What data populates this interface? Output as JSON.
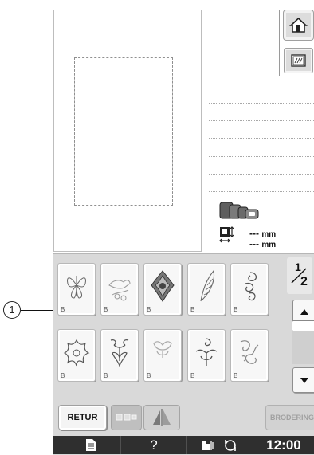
{
  "callout": {
    "number": "1"
  },
  "preview": {
    "thread_lines": 6
  },
  "size_display": {
    "height_value": "---",
    "height_unit": "mm",
    "width_value": "---",
    "width_unit": "mm"
  },
  "icons": {
    "home": "home-icon",
    "frame": "embroidery-frame-icon",
    "hoop_sizes": "hoop-sizes-icon",
    "size": "pattern-size-icon"
  },
  "pattern_grid": {
    "rows": [
      {
        "patterns": [
          {
            "label": "B",
            "icon": "butterfly-pattern-icon"
          },
          {
            "label": "B",
            "icon": "bird-branch-pattern-icon"
          },
          {
            "label": "B",
            "icon": "ornate-medallion-pattern-icon"
          },
          {
            "label": "B",
            "icon": "feather-pattern-icon"
          },
          {
            "label": "B",
            "icon": "swirl-scroll-pattern-icon"
          }
        ]
      },
      {
        "patterns": [
          {
            "label": "B",
            "icon": "flower-pattern-icon"
          },
          {
            "label": "B",
            "icon": "fleur-ornament-pattern-icon"
          },
          {
            "label": "B",
            "icon": "crest-ornament-pattern-icon"
          },
          {
            "label": "B",
            "icon": "scroll-motif-pattern-icon"
          },
          {
            "label": "B",
            "icon": "knot-swirl-pattern-icon"
          }
        ]
      }
    ]
  },
  "pagination": {
    "current": "1",
    "total": "2"
  },
  "buttons": {
    "retur": "RETUR",
    "embroider": "BRODERING"
  },
  "status_bar": {
    "help": "?",
    "time": "12:00"
  }
}
